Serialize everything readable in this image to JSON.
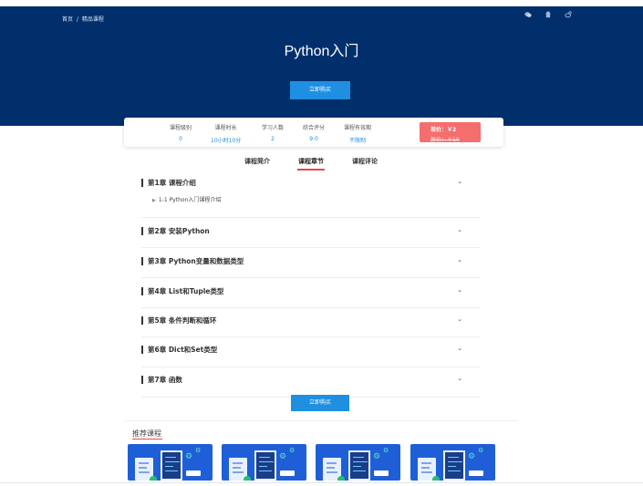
{
  "breadcrumb": {
    "home": "首页",
    "separator": "/",
    "current": "精品课程"
  },
  "header_icons": [
    "wechat-icon",
    "qq-icon",
    "weibo-icon"
  ],
  "course": {
    "title": "Python入门",
    "buy_label": "立即购买"
  },
  "stats": [
    {
      "label": "课程级别",
      "value": "0"
    },
    {
      "label": "课程时长",
      "value": "10小时10分"
    },
    {
      "label": "学习人数",
      "value": "2"
    },
    {
      "label": "综合评分",
      "value": "9.0"
    },
    {
      "label": "课程有效期",
      "value": "不限制"
    }
  ],
  "price": {
    "now": "现价：￥2",
    "original": "原价：￥10"
  },
  "tabs": [
    {
      "label": "课程简介",
      "active": false
    },
    {
      "label": "课程章节",
      "active": true
    },
    {
      "label": "课程评论",
      "active": false
    }
  ],
  "chapters": [
    {
      "title": "第1章 课程介绍",
      "expanded": true,
      "lessons": [
        "1-1 Python入门课程介绍"
      ]
    },
    {
      "title": "第2章 安装Python",
      "expanded": false,
      "lessons": []
    },
    {
      "title": "第3章 Python变量和数据类型",
      "expanded": false,
      "lessons": []
    },
    {
      "title": "第4章 List和Tuple类型",
      "expanded": false,
      "lessons": []
    },
    {
      "title": "第5章 条件判断和循环",
      "expanded": false,
      "lessons": []
    },
    {
      "title": "第6章 Dict和Set类型",
      "expanded": false,
      "lessons": []
    },
    {
      "title": "第7章 函数",
      "expanded": false,
      "lessons": []
    }
  ],
  "bottom_buy_label": "立即购买",
  "recommend": {
    "title": "推荐课程",
    "cards": 4
  },
  "colors": {
    "hero_bg": "#002f6c",
    "accent_blue": "#1e8fe1",
    "price_red": "#f46e6e",
    "tab_underline": "#e6484a"
  }
}
